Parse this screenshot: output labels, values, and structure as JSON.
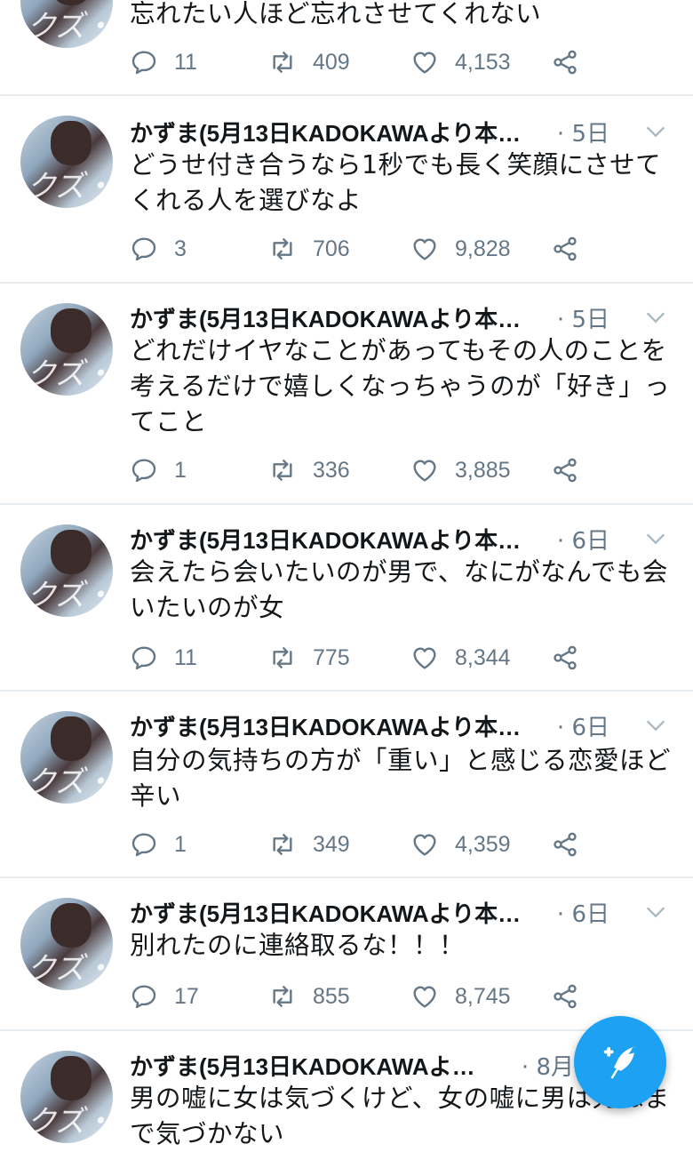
{
  "tweets": [
    {
      "name": "",
      "time": "",
      "text": "忘れたい人ほど忘れさせてくれない",
      "replies": "11",
      "retweets": "409",
      "likes": "4,153"
    },
    {
      "name": "かずま(5月13日KADOKAWAより本…",
      "time": "· 5日",
      "text": "どうせ付き合うなら1秒でも長く笑顔にさせてくれる人を選びなよ",
      "replies": "3",
      "retweets": "706",
      "likes": "9,828"
    },
    {
      "name": "かずま(5月13日KADOKAWAより本…",
      "time": "· 5日",
      "text": "どれだけイヤなことがあってもその人のことを考えるだけで嬉しくなっちゃうのが「好き」ってこと",
      "replies": "1",
      "retweets": "336",
      "likes": "3,885"
    },
    {
      "name": "かずま(5月13日KADOKAWAより本…",
      "time": "· 6日",
      "text": "会えたら会いたいのが男で、なにがなんでも会いたいのが女",
      "replies": "11",
      "retweets": "775",
      "likes": "8,344"
    },
    {
      "name": "かずま(5月13日KADOKAWAより本…",
      "time": "· 6日",
      "text": "自分の気持ちの方が「重い」と感じる恋愛ほど辛い",
      "replies": "1",
      "retweets": "349",
      "likes": "4,359"
    },
    {
      "name": "かずま(5月13日KADOKAWAより本…",
      "time": "· 6日",
      "text": "別れたのに連絡取るな！！！",
      "replies": "17",
      "retweets": "855",
      "likes": "8,745"
    },
    {
      "name": "かずま(5月13日KADOKAWAよ…",
      "time": "· 8月",
      "text": "男の嘘に女は気づくけど、女の嘘に男は死ぬまで気づかない",
      "replies": "",
      "retweets": "",
      "likes": ""
    }
  ],
  "icons": {
    "reply": "reply-icon",
    "retweet": "retweet-icon",
    "like": "heart-icon",
    "share": "share-icon",
    "menu": "chevron-down-icon",
    "compose": "compose-tweet-icon"
  },
  "colors": {
    "accent": "#1da1f2",
    "secondary_text": "#657786",
    "divider": "#e6ecf0"
  }
}
